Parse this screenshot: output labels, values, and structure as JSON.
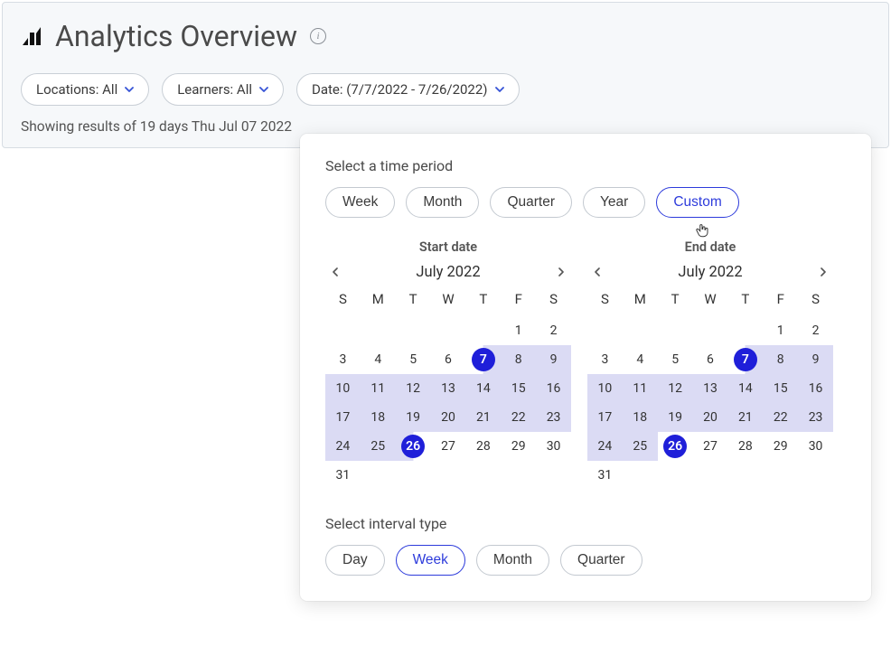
{
  "header": {
    "title": "Analytics Overview"
  },
  "filters": {
    "locations": "Locations: All",
    "learners": "Learners: All",
    "date": "Date: (7/7/2022 - 7/26/2022)"
  },
  "status": "Showing results of 19 days Thu Jul 07 2022",
  "popover": {
    "period_label": "Select a time period",
    "periods": [
      "Week",
      "Month",
      "Quarter",
      "Year",
      "Custom"
    ],
    "active_period": "Custom",
    "start": {
      "title": "Start date",
      "month_label": "July 2022",
      "blanks": 5,
      "days": 31,
      "endpoints": [
        7,
        26
      ],
      "range_start": 7,
      "range_end": 26,
      "highlight_after_start": true,
      "highlight_before_end": true
    },
    "end": {
      "title": "End date",
      "month_label": "July 2022",
      "blanks": 5,
      "days": 31,
      "endpoints": [
        7,
        26
      ],
      "range_start": 7,
      "range_end": 26,
      "highlight_after_start": true,
      "highlight_before_end": false
    },
    "dow": [
      "S",
      "M",
      "T",
      "W",
      "T",
      "F",
      "S"
    ],
    "interval_label": "Select interval type",
    "intervals": [
      "Day",
      "Week",
      "Month",
      "Quarter"
    ],
    "active_interval": "Week"
  }
}
